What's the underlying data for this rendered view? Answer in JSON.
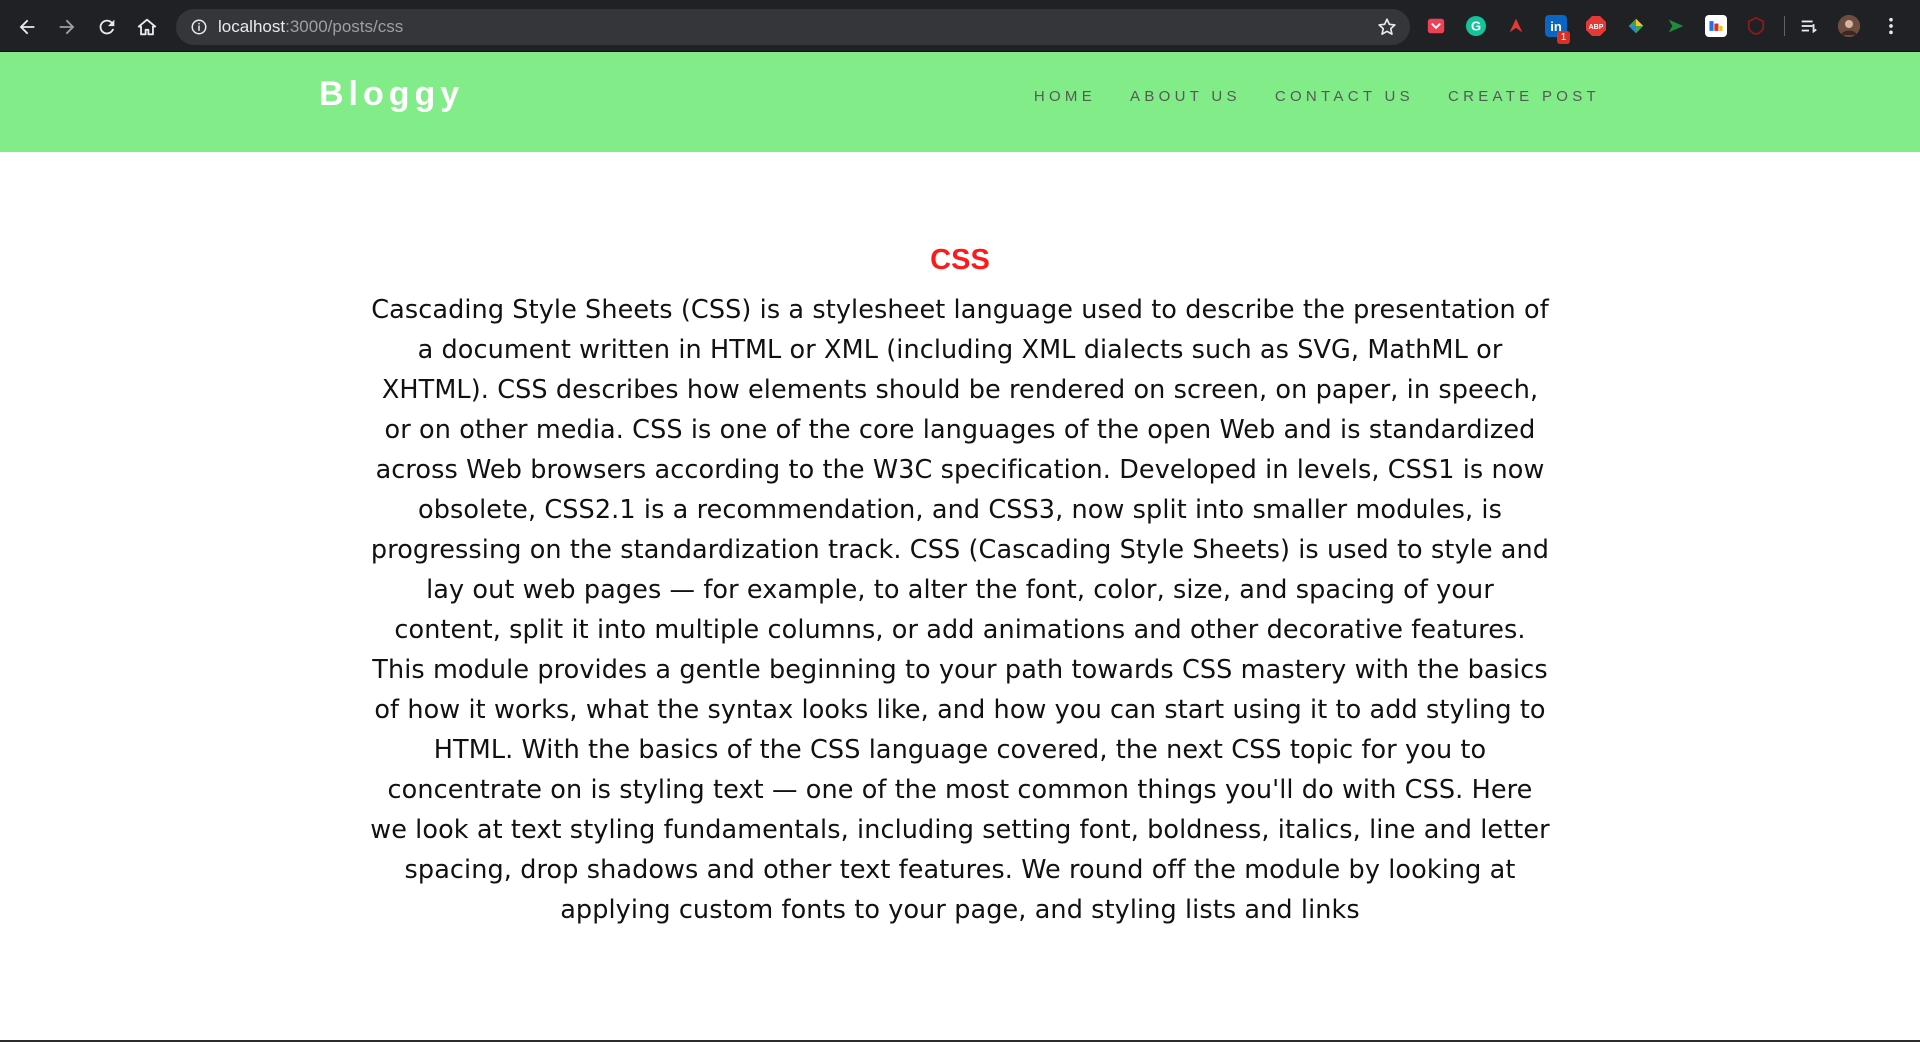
{
  "browser": {
    "url_host": "localhost",
    "url_path": ":3000/posts/css",
    "extensions": [
      {
        "name": "pocket-icon",
        "color": "#ef4056",
        "glyph": "▾"
      },
      {
        "name": "grammarly-icon",
        "color": "#15c39a",
        "glyph": "G"
      },
      {
        "name": "rocket-extension-icon",
        "color": "#e53935",
        "glyph": "➶"
      },
      {
        "name": "linkedin-icon",
        "color": "#0a66c2",
        "glyph": "in"
      },
      {
        "name": "adblock-plus-icon",
        "color": "#e53935",
        "glyph": "ABP"
      },
      {
        "name": "color-picker-icon",
        "color": "#43a047",
        "glyph": "◆"
      },
      {
        "name": "send-arrow-icon",
        "color": "#1e8e3e",
        "glyph": "➤"
      },
      {
        "name": "flag-extension-icon",
        "color": "#e8eaed",
        "glyph": "▮"
      },
      {
        "name": "shield-extension-icon",
        "color": "#8b1a1a",
        "glyph": "⬡"
      }
    ],
    "linkedin_badge": "1"
  },
  "site": {
    "brand": "Bloggy",
    "nav": [
      "HOME",
      "ABOUT US",
      "CONTACT US",
      "CREATE POST"
    ]
  },
  "post": {
    "title": "CSS",
    "body": "Cascading Style Sheets (CSS) is a stylesheet language used to describe the presentation of a document written in HTML or XML (including XML dialects such as SVG, MathML or XHTML). CSS describes how elements should be rendered on screen, on paper, in speech, or on other media. CSS is one of the core languages of the open Web and is standardized across Web browsers according to the W3C specification. Developed in levels, CSS1 is now obsolete, CSS2.1 is a recommendation, and CSS3, now split into smaller modules, is progressing on the standardization track. CSS (Cascading Style Sheets) is used to style and lay out web pages — for example, to alter the font, color, size, and spacing of your content, split it into multiple columns, or add animations and other decorative features. This module provides a gentle beginning to your path towards CSS mastery with the basics of how it works, what the syntax looks like, and how you can start using it to add styling to HTML. With the basics of the CSS language covered, the next CSS topic for you to concentrate on is styling text — one of the most common things you'll do with CSS. Here we look at text styling fundamentals, including setting font, boldness, italics, line and letter spacing, drop shadows and other text features. We round off the module by looking at applying custom fonts to your page, and styling lists and links"
  }
}
